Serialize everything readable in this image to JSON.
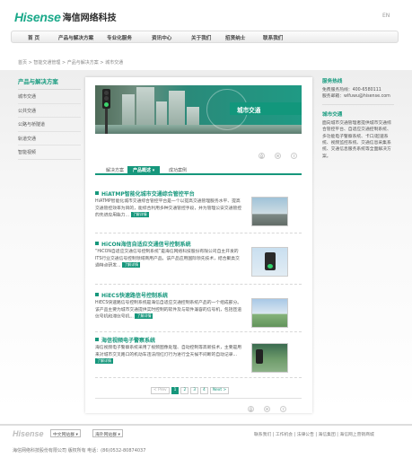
{
  "header": {
    "brand_en": "Hisense",
    "brand_cn": "海信网络科技",
    "lang": "EN"
  },
  "nav": [
    "首 页",
    "产品与解决方案",
    "专业化服务",
    "资讯中心",
    "关于我们",
    "招贤纳士",
    "联系我们"
  ],
  "breadcrumb": "首页 > 智能交通管理 > 产品与解决方案 > 城市交通",
  "sidebar": {
    "title": "产品与解决方案",
    "items": [
      "城市交通",
      "公共交通",
      "公路与桥隧道",
      "轨道交通",
      "智能视频"
    ]
  },
  "hero": {
    "tag": "城市交通"
  },
  "tools": [
    "print-icon",
    "mail-icon",
    "share-icon"
  ],
  "tabs": [
    "解决方案",
    "产品概述",
    "成功案例"
  ],
  "tabs_active": 1,
  "items": [
    {
      "title": "HiATMP智能化城市交通综合管控平台",
      "desc": "HiATMP智能化城市交通综合管控平台是一个以提高交通管理服务水平、提高交通管控效率为目的，能综合利用多种交通管控手段，并为管理公安交通管控的先进应用能力...",
      "more": "了解详情"
    },
    {
      "title": "HiCON海信自适应交通信号控制系统",
      "desc": "“HiCON自适应交通信号控制系统”是海信网络科技股份有限公司自主开发的ITS行业交通信号控制领域商用产品。该产品应用国际领先技术，结合聚类交通特点研发...",
      "more": "了解详情"
    },
    {
      "title": "HiECS快速路信号控制系统",
      "desc": "HiECS快速路信号控制系统是海信自适应交通控制系统产品的一个组成部分。该产品主要为城市交通提供实时控制的软件及与软件兼容的信号机，包括匝道信号机和滞信号机...",
      "more": "了解详情"
    },
    {
      "title": "海信视频电子警察系统",
      "desc": "海信视频电子警察系统采用了视频图像处理、自动控制等高新技术，主要是用来对城市交叉路口的机动车违法闯红灯行为进行全天候不间断的自动记录...",
      "more": "了解详情"
    }
  ],
  "pager": [
    "< Prev",
    "1",
    "2",
    "3",
    "4",
    "Next >"
  ],
  "pager_current": "1",
  "right": {
    "hotline_title": "服务热线",
    "hotline_text": "免费服务热线：400-6580111",
    "email_text": "服务邮箱：wlfuwu@hisense.com",
    "section_title": "城市交通",
    "section_text": "面向城市交通管理者提供城市交通综合管控平台、自适应交通控制系统、多功能电子警察系统、卡口/超速系统、视频监控系统、交通信息采集系统、交通信息服务系统等全面解决方案。"
  },
  "footer": {
    "logo": "Hisense",
    "select1": "中文网站群",
    "select2": "海外网站群",
    "links": "联系我们 | 工作机会 | 法律公告 | 海信集团 | 海信网上营销商城",
    "copyright": "海信网络科技股份有限公司  版权所有  电话：(86)0532-80874037"
  },
  "colors": {
    "accent": "#16977c"
  }
}
